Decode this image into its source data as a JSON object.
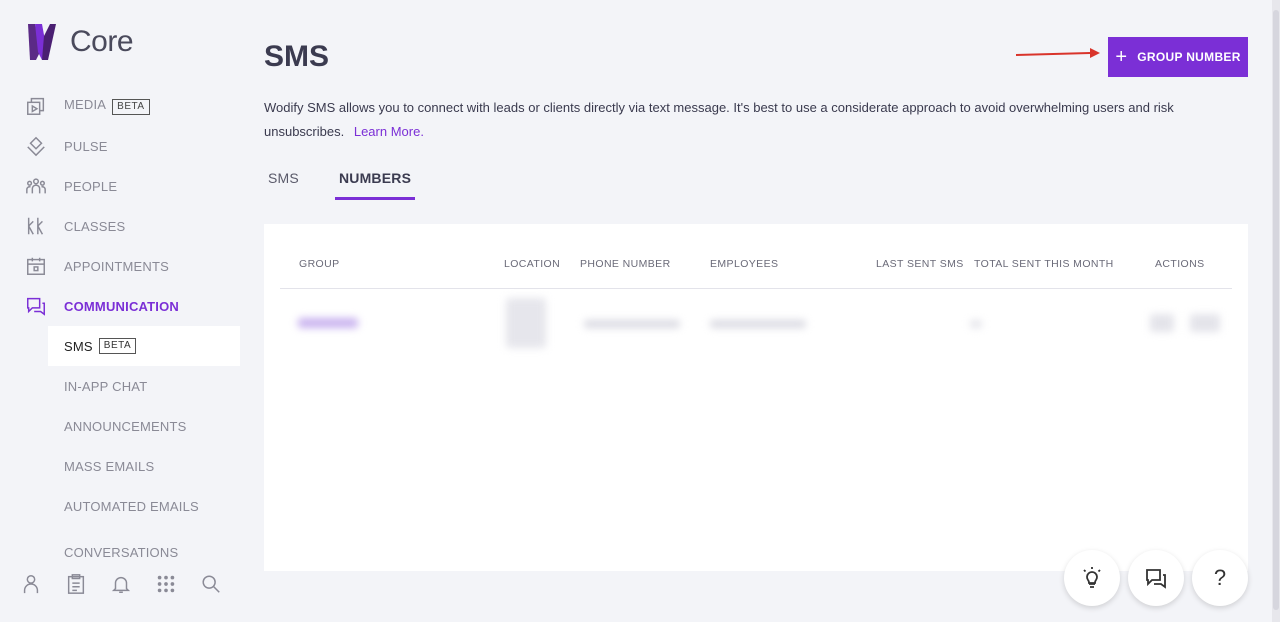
{
  "app": {
    "logo_text": "Core"
  },
  "sidebar": {
    "items": [
      {
        "label": "MEDIA",
        "badge": "BETA",
        "icon": "media-icon"
      },
      {
        "label": "PULSE",
        "icon": "pulse-icon"
      },
      {
        "label": "PEOPLE",
        "icon": "people-icon"
      },
      {
        "label": "CLASSES",
        "icon": "classes-icon"
      },
      {
        "label": "APPOINTMENTS",
        "icon": "calendar-icon"
      },
      {
        "label": "COMMUNICATION",
        "icon": "chat-bubbles-icon"
      }
    ],
    "subitems": [
      {
        "label": "SMS",
        "badge": "BETA"
      },
      {
        "label": "IN-APP CHAT"
      },
      {
        "label": "ANNOUNCEMENTS"
      },
      {
        "label": "MASS EMAILS"
      },
      {
        "label": "AUTOMATED EMAILS"
      },
      {
        "label": "CONVERSATIONS"
      }
    ],
    "bottom_icons": [
      "user-icon",
      "clipboard-icon",
      "bell-icon",
      "apps-grid-icon",
      "search-icon"
    ]
  },
  "main": {
    "title": "SMS",
    "description": "Wodify SMS allows you to connect with leads or clients directly via text message. It's best to use a considerate approach to avoid overwhelming users and risk unsubscribes.",
    "learn_more": "Learn More.",
    "group_button": {
      "plus": "+",
      "label": "GROUP NUMBER"
    },
    "tabs": [
      {
        "label": "SMS"
      },
      {
        "label": "NUMBERS"
      }
    ],
    "table": {
      "columns": [
        "GROUP",
        "LOCATION",
        "PHONE NUMBER",
        "EMPLOYEES",
        "LAST SENT SMS",
        "TOTAL SENT THIS MONTH",
        "ACTIONS"
      ]
    }
  },
  "fabs": {
    "help": "?"
  },
  "colors": {
    "accent": "#7b2fd6",
    "arrow": "#d9342b"
  }
}
